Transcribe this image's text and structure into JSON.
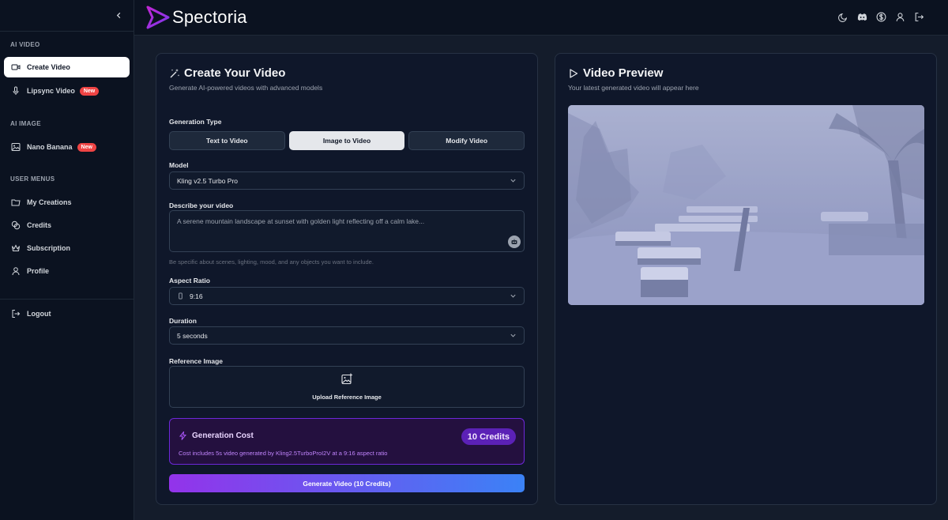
{
  "sidebar": {
    "sections": {
      "ai_video": "AI VIDEO",
      "ai_image": "AI IMAGE",
      "user_menus": "USER MENUS"
    },
    "items": [
      {
        "label": "Create Video",
        "icon": "video-camera-icon",
        "active": true
      },
      {
        "label": "Lipsync Video",
        "icon": "microphone-icon",
        "badge": "New"
      },
      {
        "label": "Nano Banana",
        "icon": "image-icon",
        "badge": "New"
      },
      {
        "label": "My Creations",
        "icon": "folder-icon"
      },
      {
        "label": "Credits",
        "icon": "coins-icon"
      },
      {
        "label": "Subscription",
        "icon": "crown-icon"
      },
      {
        "label": "Profile",
        "icon": "user-icon"
      },
      {
        "label": "Logout",
        "icon": "logout-icon"
      }
    ]
  },
  "header": {
    "brand": "Spectoria",
    "icons": [
      "moon-icon",
      "discord-icon",
      "dollar-icon",
      "user-icon",
      "logout-icon"
    ]
  },
  "create": {
    "title": "Create Your Video",
    "subtitle": "Generate AI-powered videos with advanced models",
    "generation_type_label": "Generation Type",
    "generation_types": [
      "Text to Video",
      "Image to Video",
      "Modify Video"
    ],
    "selected_generation_type": "Image to Video",
    "model_label": "Model",
    "model_value": "Kling v2.5 Turbo Pro",
    "describe_label": "Describe your video",
    "describe_placeholder": "A serene mountain landscape at sunset with golden light reflecting off a calm lake...",
    "describe_hint": "Be specific about scenes, lighting, mood, and any objects you want to include.",
    "aspect_label": "Aspect Ratio",
    "aspect_value": "9:16",
    "duration_label": "Duration",
    "duration_value": "5 seconds",
    "reference_label": "Reference Image",
    "upload_label": "Upload Reference Image",
    "cost_title": "Generation Cost",
    "cost_pill": "10 Credits",
    "cost_desc": "Cost includes 5s video generated by Kling2.5TurboProI2V at a 9:16 aspect ratio",
    "generate_button": "Generate Video (10 Credits)"
  },
  "preview": {
    "title": "Video Preview",
    "subtitle": "Your latest generated video will appear here"
  },
  "colors": {
    "brand_purple": "#9333ea",
    "gradient_end": "#3b82f6",
    "badge_red": "#ef4444"
  }
}
